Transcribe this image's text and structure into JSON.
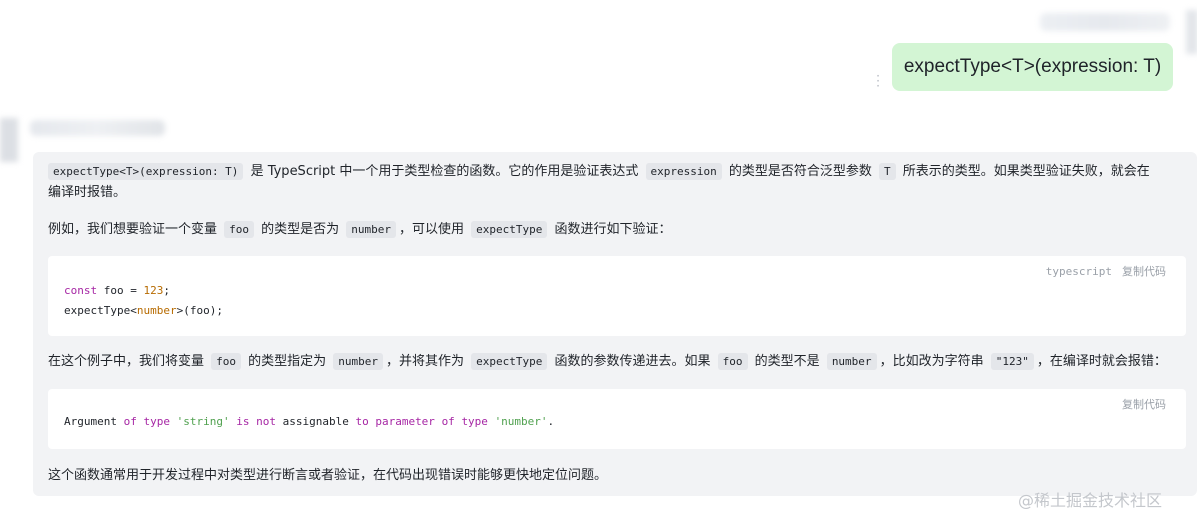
{
  "user_message": "expectType<T>(expression: T)",
  "answer": {
    "p1": {
      "code1": "expectType<T>(expression: T)",
      "text1": " 是 TypeScript 中一个用于类型检查的函数。它的作用是验证表达式 ",
      "code2": "expression",
      "text2": " 的类型是否符合泛型参数 ",
      "code3": "T",
      "text3": " 所表示的类型。如果类型验证失败，就会在",
      "line2": "编译时报错。"
    },
    "p2": {
      "text1": "例如，我们想要验证一个变量 ",
      "code1": "foo",
      "text2": " 的类型是否为 ",
      "code2": "number",
      "text3": "，可以使用 ",
      "code3": "expectType",
      "text4": " 函数进行如下验证："
    },
    "code_block_1": {
      "lang": "typescript",
      "copy_label": "复制代码",
      "line1": {
        "kw": "const",
        "a": " foo = ",
        "num": "123",
        "b": ";"
      },
      "line2": {
        "a": "expectType<",
        "typ": "number",
        "b": ">(foo);"
      }
    },
    "p3": {
      "text1": "在这个例子中，我们将变量 ",
      "code1": "foo",
      "text2": " 的类型指定为 ",
      "code2": "number",
      "text3": "，并将其作为 ",
      "code3": "expectType",
      "text4": " 函数的参数传递进去。如果 ",
      "code4": "foo",
      "text5": " 的类型不是 ",
      "code5": "number",
      "text6": "，比如改为字符串 ",
      "code6": "\"123\"",
      "text7": "，在编译时就会报错："
    },
    "code_block_2": {
      "copy_label": "复制代码",
      "t1": "Argument ",
      "k1": "of",
      "t2": " ",
      "k2": "type",
      "t3": " ",
      "s1": "'string'",
      "t4": " ",
      "k3": "is",
      "t5": " ",
      "k4": "not",
      "t6": " assignable ",
      "k5": "to",
      "t7": " ",
      "k6": "parameter",
      "t8": " ",
      "k7": "of",
      "t9": " ",
      "k8": "type",
      "t10": " ",
      "s2": "'number'",
      "t11": "."
    },
    "p4": "这个函数通常用于开发过程中对类型进行断言或者验证，在代码出现错误时能够更快地定位问题。"
  },
  "watermark": "@稀土掘金技术社区",
  "icons": {
    "more": "more-vertical-icon"
  }
}
